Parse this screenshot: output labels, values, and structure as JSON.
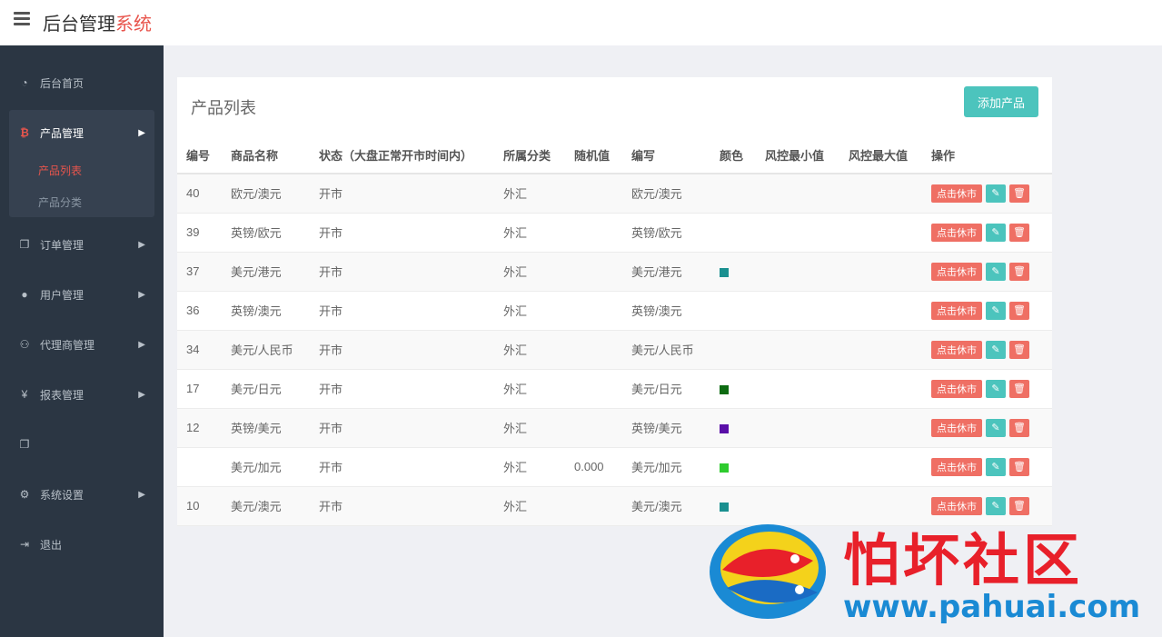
{
  "header": {
    "title_main": "后台管理",
    "title_accent": "系统"
  },
  "sidebar": {
    "items": [
      {
        "label": "后台首页",
        "icon": "dashboard-icon"
      },
      {
        "label": "产品管理",
        "icon": "bitcoin-icon"
      },
      {
        "label": "订单管理",
        "icon": "copy-icon"
      },
      {
        "label": "用户管理",
        "icon": "user-icon"
      },
      {
        "label": "代理商管理",
        "icon": "sitemap-icon"
      },
      {
        "label": "报表管理",
        "icon": "yen-icon"
      },
      {
        "label": "",
        "icon": "copy-icon"
      },
      {
        "label": "系统设置",
        "icon": "gears-icon"
      },
      {
        "label": "退出",
        "icon": "sign-out-icon"
      }
    ],
    "sub_items": [
      "产品列表",
      "产品分类"
    ]
  },
  "panel": {
    "title": "产品列表",
    "add_button": "添加产品"
  },
  "table": {
    "headers": [
      "编号",
      "商品名称",
      "状态（大盘正常开市时间内）",
      "所属分类",
      "随机值",
      "编写",
      "颜色",
      "风控最小值",
      "风控最大值",
      "操作"
    ],
    "rows": [
      {
        "id": "40",
        "name": "欧元/澳元",
        "status": "开市",
        "category": "外汇",
        "random": "",
        "code": "欧元/澳元",
        "color": ""
      },
      {
        "id": "39",
        "name": "英镑/欧元",
        "status": "开市",
        "category": "外汇",
        "random": "",
        "code": "英镑/欧元",
        "color": ""
      },
      {
        "id": "37",
        "name": "美元/港元",
        "status": "开市",
        "category": "外汇",
        "random": "",
        "code": "美元/港元",
        "color": "#1a9090"
      },
      {
        "id": "36",
        "name": "英镑/澳元",
        "status": "开市",
        "category": "外汇",
        "random": "",
        "code": "英镑/澳元",
        "color": ""
      },
      {
        "id": "34",
        "name": "美元/人民币",
        "status": "开市",
        "category": "外汇",
        "random": "",
        "code": "美元/人民币",
        "color": ""
      },
      {
        "id": "17",
        "name": "美元/日元",
        "status": "开市",
        "category": "外汇",
        "random": "",
        "code": "美元/日元",
        "color": "#0d6b12"
      },
      {
        "id": "12",
        "name": "英镑/美元",
        "status": "开市",
        "category": "外汇",
        "random": "",
        "code": "英镑/美元",
        "color": "#5a0fa8"
      },
      {
        "id": "",
        "name": "美元/加元",
        "status": "开市",
        "category": "外汇",
        "random": "0.000",
        "code": "美元/加元",
        "color": "#2ecb2e"
      },
      {
        "id": "10",
        "name": "美元/澳元",
        "status": "开市",
        "category": "外汇",
        "random": "",
        "code": "美元/澳元",
        "color": "#1a9090"
      }
    ],
    "close_label": "点击休市",
    "edit_icon": "pencil-icon",
    "delete_icon": "trash-icon"
  },
  "watermark": {
    "text": "怕坏社区",
    "url": "www.pahuai.com"
  }
}
